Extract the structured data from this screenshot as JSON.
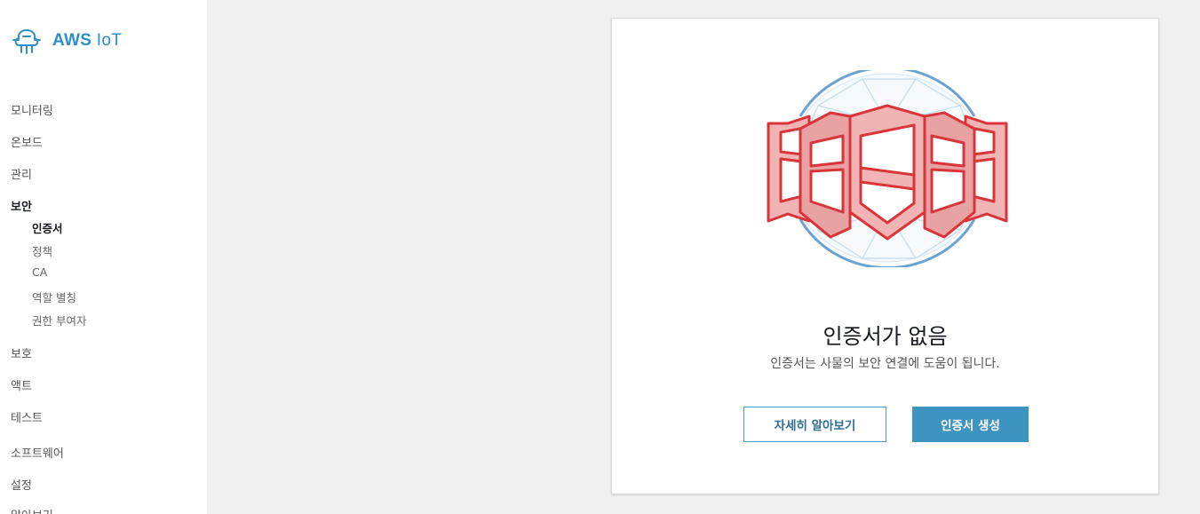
{
  "app": {
    "logo_bold": "AWS",
    "logo_rest": "IoT"
  },
  "sidebar": {
    "items": [
      {
        "label": "모니터링"
      },
      {
        "label": "온보드"
      },
      {
        "label": "관리"
      },
      {
        "label": "보안",
        "active": true
      },
      {
        "label": "보호"
      },
      {
        "label": "액트"
      },
      {
        "label": "테스트"
      },
      {
        "label": "소프트웨어"
      },
      {
        "label": "설정"
      },
      {
        "label": "알아보기"
      }
    ],
    "security_sub": [
      {
        "label": "인증서",
        "active": true
      },
      {
        "label": "정책"
      },
      {
        "label": "CA"
      },
      {
        "label": "역할 별칭"
      },
      {
        "label": "권한 부여자"
      }
    ]
  },
  "main": {
    "empty_title": "인증서가 없음",
    "empty_desc": "인증서는 사물의 보안 연결에 도움이 됩니다.",
    "learn_more_label": "자세히 알아보기",
    "create_label": "인증서 생성",
    "illustration_icon": "shield-certificate-icon"
  },
  "colors": {
    "accent": "#3e94c1",
    "brand": "#2d8fc7",
    "shield_red": "#d9343a",
    "shield_fill": "#f0b4b4"
  }
}
